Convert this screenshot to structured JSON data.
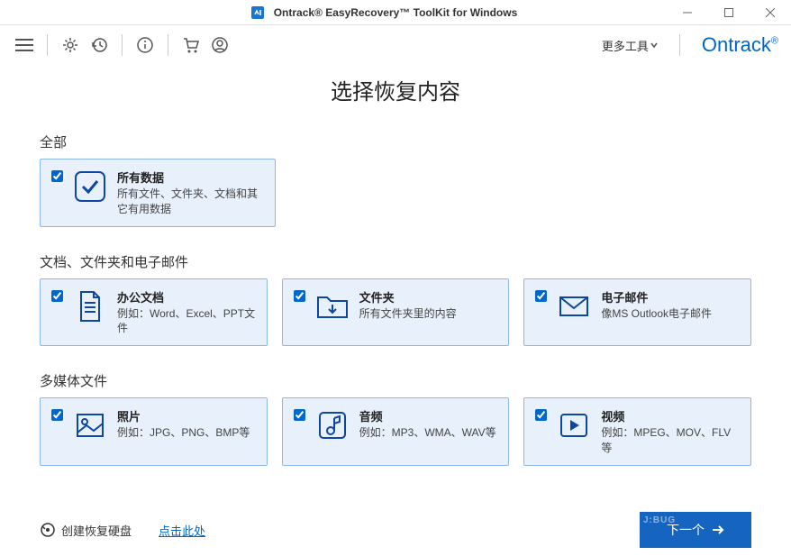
{
  "window": {
    "title": "Ontrack® EasyRecovery™ ToolKit for Windows"
  },
  "toolbar": {
    "more_tools": "更多工具",
    "brand": "Ontrack"
  },
  "page": {
    "title": "选择恢复内容"
  },
  "sections": {
    "all": {
      "label": "全部",
      "card": {
        "title": "所有数据",
        "desc": "所有文件、文件夹、文档和其它有用数据"
      }
    },
    "docs": {
      "label": "文档、文件夹和电子邮件",
      "cards": [
        {
          "title": "办公文档",
          "desc": "例如：Word、Excel、PPT文件"
        },
        {
          "title": "文件夹",
          "desc": "所有文件夹里的内容"
        },
        {
          "title": "电子邮件",
          "desc": "像MS Outlook电子邮件"
        }
      ]
    },
    "media": {
      "label": "多媒体文件",
      "cards": [
        {
          "title": "照片",
          "desc": "例如：JPG、PNG、BMP等"
        },
        {
          "title": "音频",
          "desc": "例如：MP3、WMA、WAV等"
        },
        {
          "title": "视频",
          "desc": "例如：MPEG、MOV、FLV等"
        }
      ]
    }
  },
  "footer": {
    "create_disk": "创建恢复硬盘",
    "click_here": "点击此处",
    "next": "下一个"
  }
}
